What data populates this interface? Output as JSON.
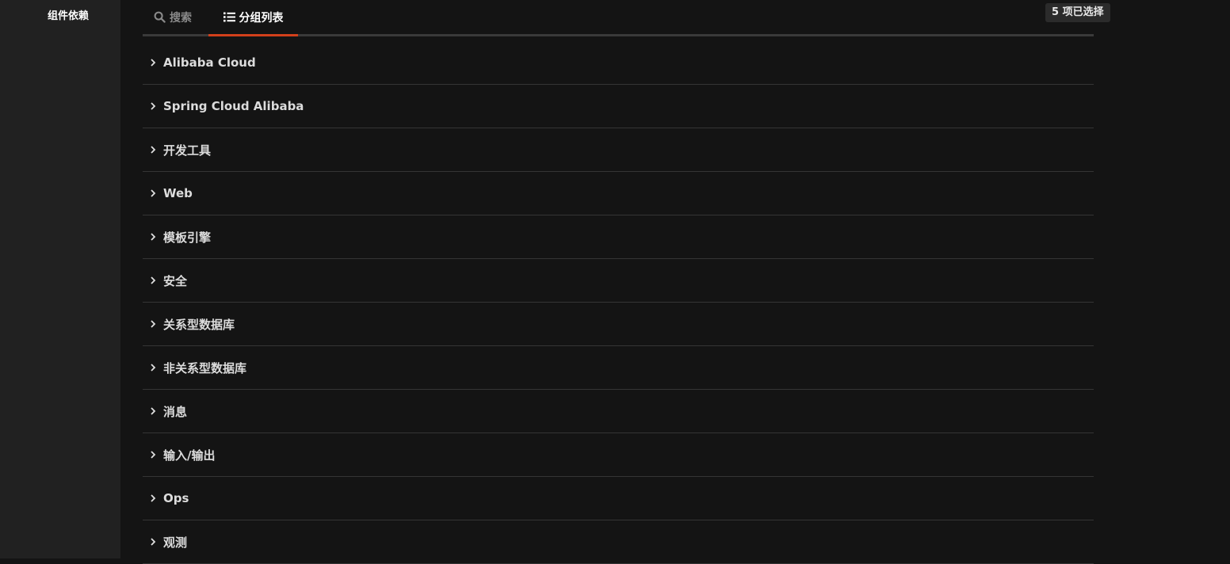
{
  "sidebar": {
    "title": "组件依赖"
  },
  "tabs": [
    {
      "label": "搜索",
      "icon": "search-icon",
      "active": false
    },
    {
      "label": "分组列表",
      "icon": "list-icon",
      "active": true
    }
  ],
  "selection_badge": "5 项已选择",
  "groups": [
    {
      "label": "Alibaba Cloud"
    },
    {
      "label": "Spring Cloud Alibaba"
    },
    {
      "label": "开发工具"
    },
    {
      "label": "Web"
    },
    {
      "label": "模板引擎"
    },
    {
      "label": "安全"
    },
    {
      "label": "关系型数据库"
    },
    {
      "label": "非关系型数据库"
    },
    {
      "label": "消息"
    },
    {
      "label": "输入/输出"
    },
    {
      "label": "Ops"
    },
    {
      "label": "观测"
    }
  ],
  "colors": {
    "sidebar_bg": "#212121",
    "main_bg": "#141414",
    "accent": "#d2401b",
    "divider": "#353535"
  }
}
